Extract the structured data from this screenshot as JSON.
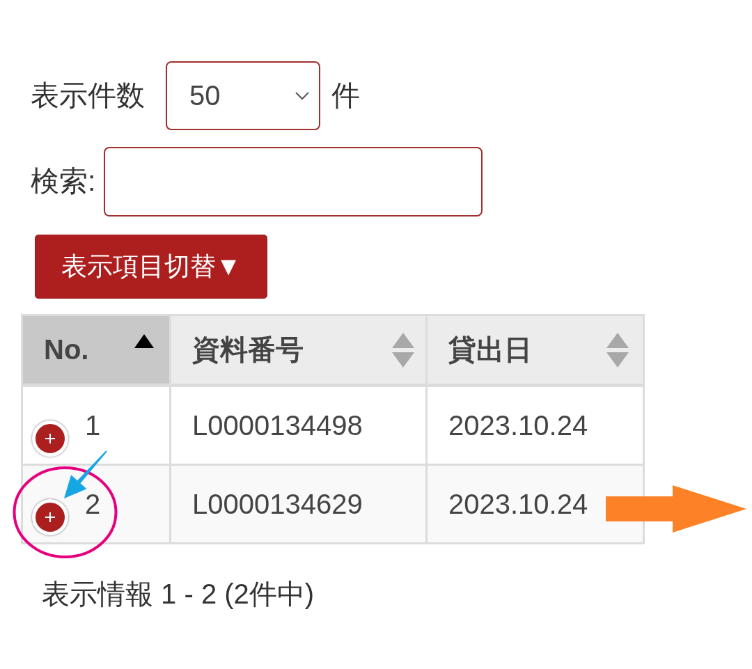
{
  "page_length": {
    "label": "表示件数",
    "value": "50",
    "unit": "件"
  },
  "search": {
    "label": "検索:"
  },
  "column_toggle_button": {
    "label": "表示項目切替▼"
  },
  "table": {
    "columns": [
      {
        "label": "No.",
        "sorted": true,
        "ascending": true
      },
      {
        "label": "資料番号",
        "sorted": false
      },
      {
        "label": "貸出日",
        "sorted": false
      }
    ],
    "rows": [
      {
        "expanded": false,
        "cells": [
          "1",
          "L0000134498",
          "2023.10.24"
        ]
      },
      {
        "expanded": false,
        "cells": [
          "2",
          "L0000134629",
          "2023.10.24"
        ]
      }
    ]
  },
  "info": "表示情報 1 - 2 (2件中)"
}
